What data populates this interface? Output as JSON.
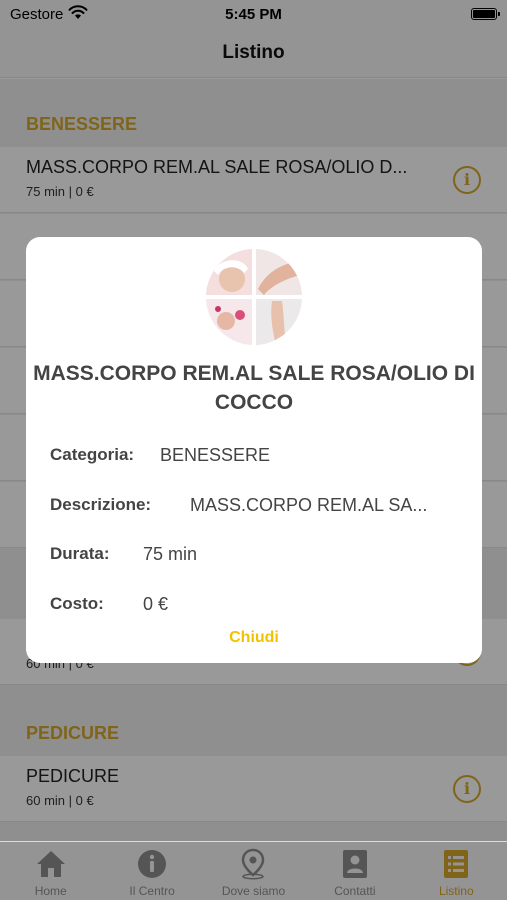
{
  "status_bar": {
    "carrier": "Gestore",
    "time": "5:45 PM"
  },
  "nav": {
    "title": "Listino"
  },
  "list": {
    "section_1": {
      "header": "BENESSERE",
      "row_title": "MASS.CORPO REM.AL SALE ROSA/OLIO D...",
      "row_sub": "75 min | 0 €"
    },
    "partial_row": {
      "row_sub": "60 min | 0 €"
    },
    "section_2": {
      "header": "PEDICURE",
      "row_title": "PEDICURE",
      "row_sub": "60 min | 0 €"
    }
  },
  "modal": {
    "title": "MASS.CORPO REM.AL SALE ROSA/OLIO DI COCCO",
    "categoria_label": "Categoria:",
    "categoria_value": "BENESSERE",
    "descrizione_label": "Descrizione:",
    "descrizione_value": "MASS.CORPO REM.AL SA...",
    "durata_label": "Durata:",
    "durata_value": "75 min",
    "costo_label": "Costo:",
    "costo_value": "0 €",
    "close_label": "Chiudi"
  },
  "tabbar": {
    "home": "Home",
    "centro": "Il Centro",
    "dove": "Dove siamo",
    "contatti": "Contatti",
    "listino": "Listino",
    "active_tab": "listino"
  },
  "colors": {
    "accent_gold": "#d4a72c",
    "close_yellow": "#f2c200",
    "inactive_gray": "#8e8e8e"
  }
}
